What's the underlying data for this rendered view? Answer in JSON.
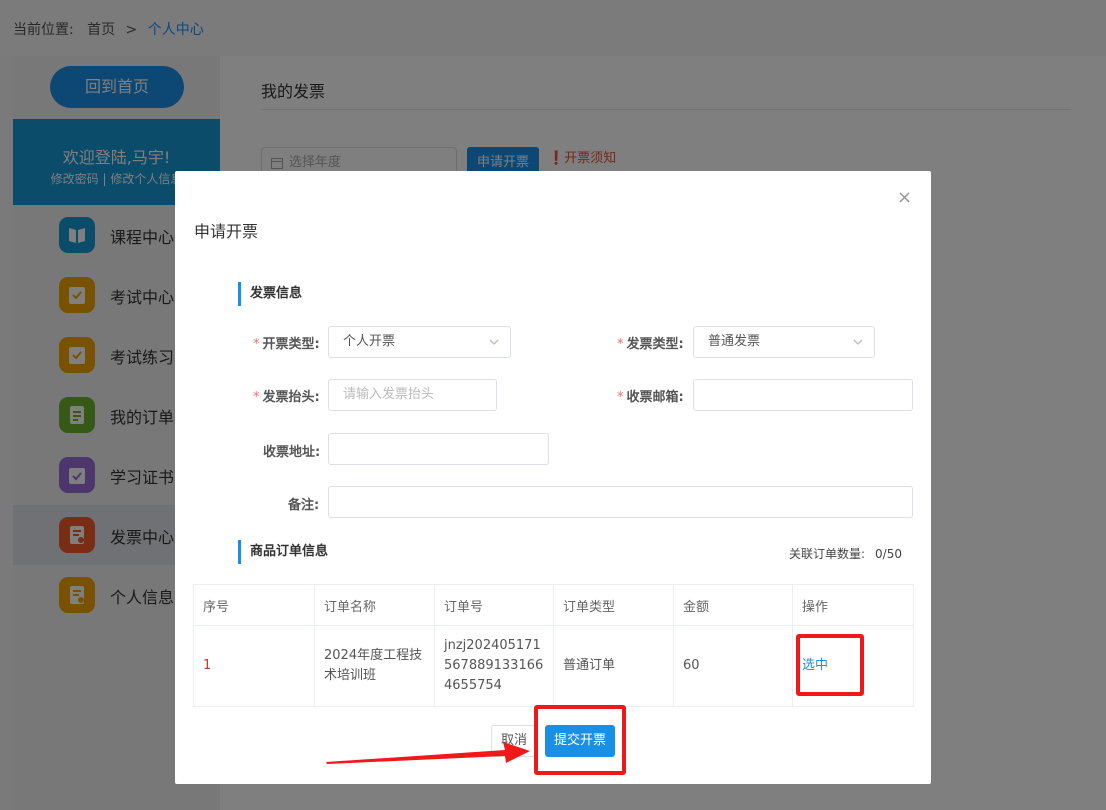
{
  "breadcrumb": {
    "prefix": "当前位置:",
    "home": "首页",
    "separator": ">",
    "current": "个人中心"
  },
  "sidebar": {
    "home_button": "回到首页",
    "welcome": "欢迎登陆,马宇!",
    "links": "修改密码 | 修改个人信息",
    "items": [
      {
        "label": "课程中心",
        "icon": "book-icon",
        "color": "#1598d3"
      },
      {
        "label": "考试中心",
        "icon": "exam-icon",
        "color": "#f0a500"
      },
      {
        "label": "考试练习",
        "icon": "exam-practice-icon",
        "color": "#f0a500"
      },
      {
        "label": "我的订单",
        "icon": "order-icon",
        "color": "#6fb22f"
      },
      {
        "label": "学习证书",
        "icon": "certificate-icon",
        "color": "#9a6cd6"
      },
      {
        "label": "发票中心",
        "icon": "invoice-icon",
        "color": "#f05a28",
        "active": true
      },
      {
        "label": "个人信息",
        "icon": "profile-icon",
        "color": "#f0a500"
      }
    ]
  },
  "content": {
    "title": "我的发票",
    "year_placeholder": "选择年度",
    "apply_button": "申请开票",
    "notice": "开票须知"
  },
  "modal": {
    "title": "申请开票",
    "close": "×",
    "section_invoice": "发票信息",
    "fields": {
      "issue_type": {
        "label": "开票类型:",
        "value": "个人开票"
      },
      "invoice_type": {
        "label": "发票类型:",
        "value": "普通发票"
      },
      "invoice_header": {
        "label": "发票抬头:",
        "placeholder": "请输入发票抬头"
      },
      "email": {
        "label": "收票邮箱:",
        "value": ""
      },
      "address": {
        "label": "收票地址:",
        "value": ""
      },
      "remark": {
        "label": "备注:",
        "value": ""
      }
    },
    "section_orders": "商品订单信息",
    "related_label": "关联订单数量:",
    "related_value": "0/50",
    "table": {
      "headers": [
        "序号",
        "订单名称",
        "订单号",
        "订单类型",
        "金额",
        "操作"
      ],
      "rows": [
        {
          "index": "1",
          "name": "2024年度工程技术培训班",
          "order_no": "jnzj2024051715678891331664655754",
          "type": "普通订单",
          "amount": "60",
          "action": "选中"
        }
      ]
    },
    "cancel_button": "取消",
    "submit_button": "提交开票"
  },
  "colors": {
    "accent": "#1a8fe6",
    "highlight": "#f01818",
    "required": "#f56c6c"
  }
}
